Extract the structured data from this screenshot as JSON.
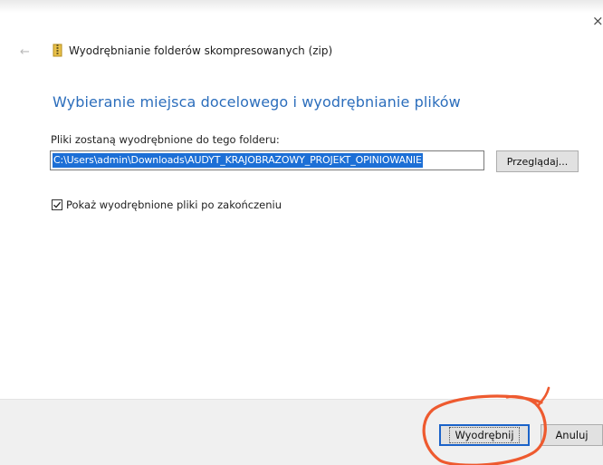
{
  "window": {
    "title": "Wyodrębnianie folderów skompresowanych (zip)",
    "close_glyph": "×",
    "back_glyph": "←"
  },
  "main": {
    "heading": "Wybieranie miejsca docelowego i wyodrębnianie plików",
    "destination_label": "Pliki zostaną wyodrębnione do tego folderu:",
    "destination_path": "C:\\Users\\admin\\Downloads\\AUDYT_KRAJOBRAZOWY_PROJEKT_OPINIOWANIE",
    "browse_label": "Przeglądaj...",
    "show_files_checkbox": {
      "label": "Pokaż wyodrębnione pliki po zakończeniu",
      "checked": true
    }
  },
  "footer": {
    "extract_label": "Wyodrębnij",
    "cancel_label": "Anuluj"
  },
  "colors": {
    "heading": "#2c6ebc",
    "selection": "#1c6fd6",
    "annotation_circle": "#ee5a2f"
  },
  "icons": {
    "title_icon": "zip-folder-icon",
    "check_icon": "checkmark-icon"
  }
}
